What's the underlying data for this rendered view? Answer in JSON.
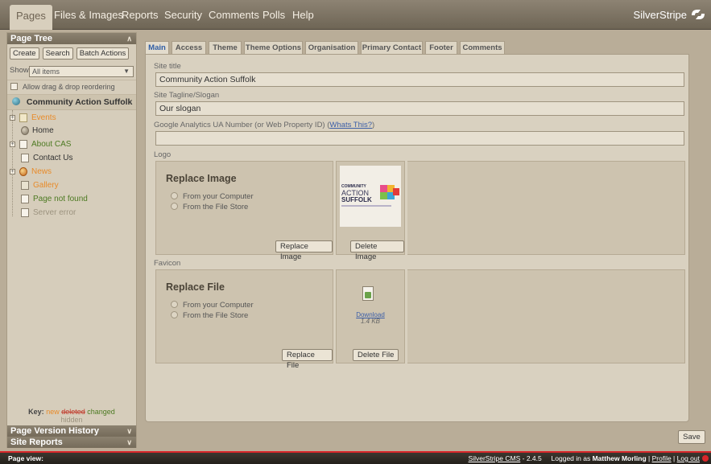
{
  "topnav": {
    "tabs": [
      "Pages",
      "Files & Images",
      "Reports",
      "Security",
      "Comments",
      "Polls",
      "Help"
    ],
    "brand": "SilverStripe"
  },
  "sidebar": {
    "page_tree_title": "Page Tree",
    "buttons": [
      "Create",
      "Search",
      "Batch Actions"
    ],
    "show_label": "Show:",
    "show_value": "All items",
    "drag_label": "Allow drag & drop reordering",
    "root": "Community Action Suffolk",
    "items": [
      {
        "label": "Events",
        "status": "new"
      },
      {
        "label": "Home",
        "status": "plain"
      },
      {
        "label": "About CAS",
        "status": "changed"
      },
      {
        "label": "Contact Us",
        "status": "plain"
      },
      {
        "label": "News",
        "status": "new"
      },
      {
        "label": "Gallery",
        "status": "new"
      },
      {
        "label": "Page not found",
        "status": "changed"
      },
      {
        "label": "Server error",
        "status": "hidden"
      }
    ],
    "key": {
      "label": "Key:",
      "new": "new",
      "deleted": "deleted",
      "changed": "changed",
      "hidden": "hidden"
    },
    "version_history": "Page Version History",
    "site_reports": "Site Reports"
  },
  "main": {
    "tabs": [
      "Main",
      "Access",
      "Theme",
      "Theme Options",
      "Organisation",
      "Primary Contact",
      "Footer",
      "Comments"
    ],
    "site_title_label": "Site title",
    "site_title_value": "Community Action Suffolk",
    "tagline_label": "Site Tagline/Slogan",
    "tagline_value": "Our slogan",
    "ga_label": "Google Analytics UA Number (or Web Property ID) (",
    "ga_link": "Whats This?",
    "ga_close": ")",
    "ga_value": "",
    "logo_label": "Logo",
    "logo_box": {
      "title": "Replace Image",
      "opt1": "From your Computer",
      "opt2": "From the File Store",
      "replace_btn": "Replace Image",
      "delete_btn": "Delete Image",
      "logo_text": [
        "COMMUNITY",
        "ACTION",
        "SUFFOLK"
      ]
    },
    "favicon_label": "Favicon",
    "favicon_box": {
      "title": "Replace File",
      "opt1": "From your Computer",
      "opt2": "From the File Store",
      "replace_btn": "Replace File",
      "delete_btn": "Delete File",
      "download": "Download",
      "size": "1.4 KB"
    },
    "save": "Save"
  },
  "statusbar": {
    "page_view": "Page view:",
    "cms_link": "SilverStripe CMS",
    "version": " - 2.4.5",
    "logged_prefix": "Logged in as ",
    "user": "Matthew Morling",
    "profile": "Profile",
    "logout": "Log out"
  },
  "colors": {
    "accent_red": "#d9262a",
    "new": "#e88b2a",
    "changed": "#4d7a22",
    "deleted": "#c03a2b",
    "link": "#3c5fa8"
  }
}
